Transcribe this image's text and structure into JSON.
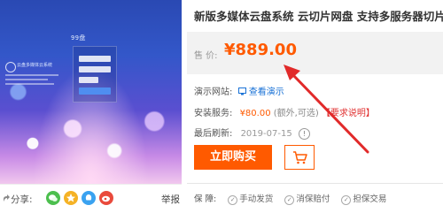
{
  "preview": {
    "login_brand": "99盘",
    "side_title": "云盘多媒体云系统"
  },
  "share": {
    "label": "分享:",
    "report": "举报"
  },
  "product": {
    "title": "新版多媒体云盘系统 云切片网盘 支持多服务器切片",
    "price_label": "售 价:",
    "price": "¥889.00",
    "demo_label": "演示网站:",
    "demo_link": "查看演示",
    "install_label": "安装服务:",
    "install_price": "¥80.00",
    "install_note": "(额外,可选)",
    "install_req": "【要求说明】",
    "refresh_label": "最后刷新:",
    "refresh_date": "2019-07-15",
    "buy_button": "立即购买"
  },
  "guarantee": {
    "label": "保 障:",
    "items": [
      "手动发货",
      "消保赔付",
      "担保交易"
    ]
  },
  "colors": {
    "accent": "#ff5a00",
    "link": "#1a72d6",
    "arrow": "#e12a2a"
  },
  "icons": {
    "share_arrow": "share-arrow-icon",
    "wechat": "wechat-icon",
    "qzone": "qzone-icon",
    "qq": "qq-icon",
    "weibo": "weibo-icon",
    "demo": "monitor-icon",
    "cart": "cart-icon",
    "warning": "warning-icon"
  }
}
